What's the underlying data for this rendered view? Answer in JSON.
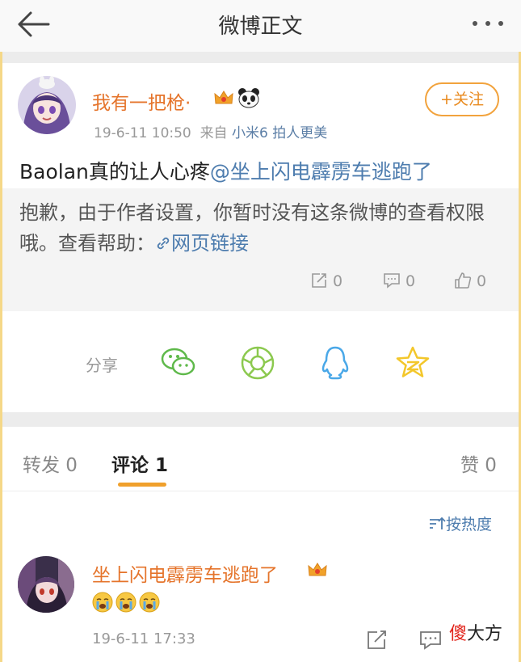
{
  "topbar": {
    "title": "微博正文",
    "back_icon": "arrow-left-icon",
    "more_icon": "more-dots-icon"
  },
  "post": {
    "username": "我有一把枪·",
    "badges": [
      "crown-icon",
      "panda-icon"
    ],
    "timestamp": "19-6-11 10:50",
    "source_prefix": "来自",
    "source": "小米6 拍人更美",
    "follow_label": "+关注",
    "text": "Baolan真的让人心疼",
    "mention": "@坐上闪电霹雳车逃跑了",
    "quote_text": "抱歉，由于作者设置，你暂时没有这条微博的查看权限哦。查看帮助：",
    "quote_link": "网页链接",
    "stats": {
      "repost": "0",
      "comment": "0",
      "like": "0"
    }
  },
  "share": {
    "label": "分享",
    "icons": [
      "wechat-icon",
      "moments-icon",
      "qq-icon",
      "qzone-icon"
    ]
  },
  "tabs": {
    "repost": "转发 0",
    "comment": "评论 1",
    "like": "赞 0"
  },
  "sort_label": "按热度",
  "comment": {
    "username": "坐上闪电霹雳车逃跑了",
    "emojis": [
      "crying-face-icon",
      "crying-face-icon",
      "crying-face-icon"
    ],
    "timestamp": "19-6-11 17:33"
  },
  "watermark": {
    "red_char": "傻",
    "rest": "大方"
  },
  "colors": {
    "accent_orange": "#e5742b",
    "link_blue": "#4d7cae",
    "tab_underline": "#f0a02c",
    "wechat_green": "#5fb94b",
    "qzone_yellow": "#f3c72b",
    "qq_blue": "#4aa8e8"
  }
}
